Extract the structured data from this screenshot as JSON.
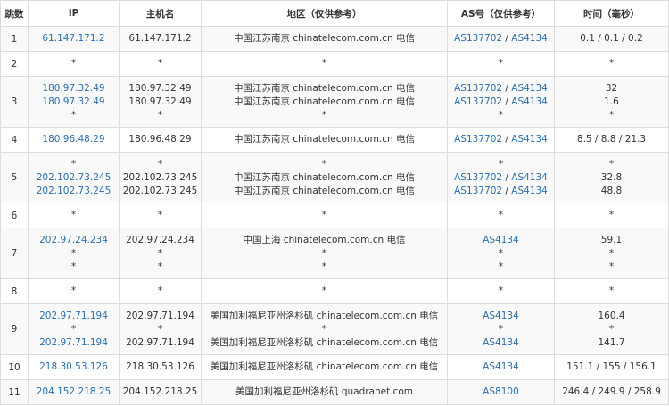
{
  "headers": {
    "hop": "跳数",
    "ip": "IP",
    "host": "主机名",
    "region": "地区（仅供参考）",
    "as": "AS号（仅供参考）",
    "time": "时间（毫秒）"
  },
  "rows": [
    {
      "hop": "1",
      "ip": [
        "61.147.171.2"
      ],
      "host": [
        "61.147.171.2"
      ],
      "region": [
        "中国江苏南京 chinatelecom.com.cn 电信"
      ],
      "as": [
        [
          "AS137702",
          "AS4134"
        ]
      ],
      "time": [
        "0.1 / 0.1 / 0.2"
      ]
    },
    {
      "hop": "2",
      "ip": [
        "*"
      ],
      "host": [
        "*"
      ],
      "region": [
        "*"
      ],
      "as": [
        "*"
      ],
      "time": [
        "*"
      ]
    },
    {
      "hop": "3",
      "ip": [
        "180.97.32.49",
        "180.97.32.49",
        "*"
      ],
      "host": [
        "180.97.32.49",
        "180.97.32.49",
        "*"
      ],
      "region": [
        "中国江苏南京 chinatelecom.com.cn 电信",
        "中国江苏南京 chinatelecom.com.cn 电信",
        "*"
      ],
      "as": [
        [
          "AS137702",
          "AS4134"
        ],
        [
          "AS137702",
          "AS4134"
        ],
        "*"
      ],
      "time": [
        "32",
        "1.6",
        "*"
      ]
    },
    {
      "hop": "4",
      "ip": [
        "180.96.48.29"
      ],
      "host": [
        "180.96.48.29"
      ],
      "region": [
        "中国江苏南京 chinatelecom.com.cn 电信"
      ],
      "as": [
        [
          "AS137702",
          "AS4134"
        ]
      ],
      "time": [
        "8.5 / 8.8 / 21.3"
      ]
    },
    {
      "hop": "5",
      "ip": [
        "*",
        "202.102.73.245",
        "202.102.73.245"
      ],
      "host": [
        "*",
        "202.102.73.245",
        "202.102.73.245"
      ],
      "region": [
        "*",
        "中国江苏南京 chinatelecom.com.cn 电信",
        "中国江苏南京 chinatelecom.com.cn 电信"
      ],
      "as": [
        "*",
        [
          "AS137702",
          "AS4134"
        ],
        [
          "AS137702",
          "AS4134"
        ]
      ],
      "time": [
        "*",
        "32.8",
        "48.8"
      ]
    },
    {
      "hop": "6",
      "ip": [
        "*"
      ],
      "host": [
        "*"
      ],
      "region": [
        "*"
      ],
      "as": [
        "*"
      ],
      "time": [
        "*"
      ]
    },
    {
      "hop": "7",
      "ip": [
        "202.97.24.234",
        "*",
        "*"
      ],
      "host": [
        "202.97.24.234",
        "*",
        "*"
      ],
      "region": [
        "中国上海 chinatelecom.com.cn 电信",
        "*",
        "*"
      ],
      "as": [
        [
          "AS4134"
        ],
        "*",
        "*"
      ],
      "time": [
        "59.1",
        "*",
        "*"
      ]
    },
    {
      "hop": "8",
      "ip": [
        "*"
      ],
      "host": [
        "*"
      ],
      "region": [
        "*"
      ],
      "as": [
        "*"
      ],
      "time": [
        "*"
      ]
    },
    {
      "hop": "9",
      "ip": [
        "202.97.71.194",
        "*",
        "202.97.71.194"
      ],
      "host": [
        "202.97.71.194",
        "*",
        "202.97.71.194"
      ],
      "region": [
        "美国加利福尼亚州洛杉矶 chinatelecom.com.cn 电信",
        "*",
        "美国加利福尼亚州洛杉矶 chinatelecom.com.cn 电信"
      ],
      "as": [
        [
          "AS4134"
        ],
        "*",
        [
          "AS4134"
        ]
      ],
      "time": [
        "160.4",
        "*",
        "141.7"
      ]
    },
    {
      "hop": "10",
      "ip": [
        "218.30.53.126"
      ],
      "host": [
        "218.30.53.126"
      ],
      "region": [
        "美国加利福尼亚州洛杉矶 chinatelecom.com.cn 电信"
      ],
      "as": [
        [
          "AS4134"
        ]
      ],
      "time": [
        "151.1 / 155 / 156.1"
      ]
    },
    {
      "hop": "11",
      "ip": [
        "204.152.218.25"
      ],
      "host": [
        "204.152.218.25"
      ],
      "region": [
        "美国加利福尼亚州洛杉矶 quadranet.com"
      ],
      "as": [
        [
          "AS8100"
        ]
      ],
      "time": [
        "246.4 / 249.9 / 258.9"
      ]
    }
  ],
  "colors": {
    "link": "#2a6fb0",
    "text": "#333333",
    "border": "#dddddd",
    "row_alt": "#f9f9f9"
  }
}
